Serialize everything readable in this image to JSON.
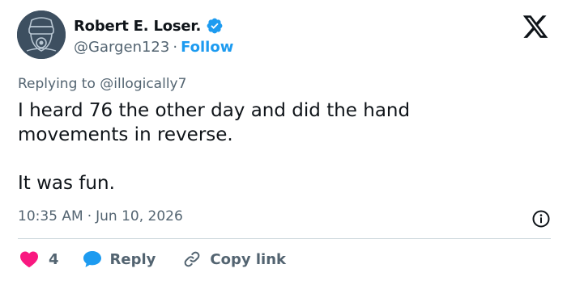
{
  "author": {
    "display_name": "Robert E. Loser.",
    "handle": "@Gargen123",
    "separator": "·",
    "follow_label": "Follow",
    "verified": true
  },
  "reply_context": {
    "prefix": "Replying to ",
    "mention": "@illogically7"
  },
  "tweet": {
    "text": "I heard 76 the other day and did the hand\nmovements in reverse.\n\nIt was fun."
  },
  "meta": {
    "time": "10:35 AM",
    "separator": "·",
    "date": "Jun 10, 2026"
  },
  "actions": {
    "like_count": "4",
    "reply_label": "Reply",
    "copy_link_label": "Copy link"
  },
  "icons": {
    "avatar": "gas-mask-icon",
    "verified": "verified-badge-icon",
    "logo": "x-logo-icon",
    "info": "info-icon",
    "like": "heart-icon",
    "reply": "speech-bubble-icon",
    "copy": "link-icon"
  },
  "colors": {
    "accent": "#1d9bf0",
    "like": "#f91880",
    "text": "#0f1419",
    "secondary": "#536471",
    "divider": "#cfd9de",
    "avatar_bg": "#3d4f60"
  }
}
